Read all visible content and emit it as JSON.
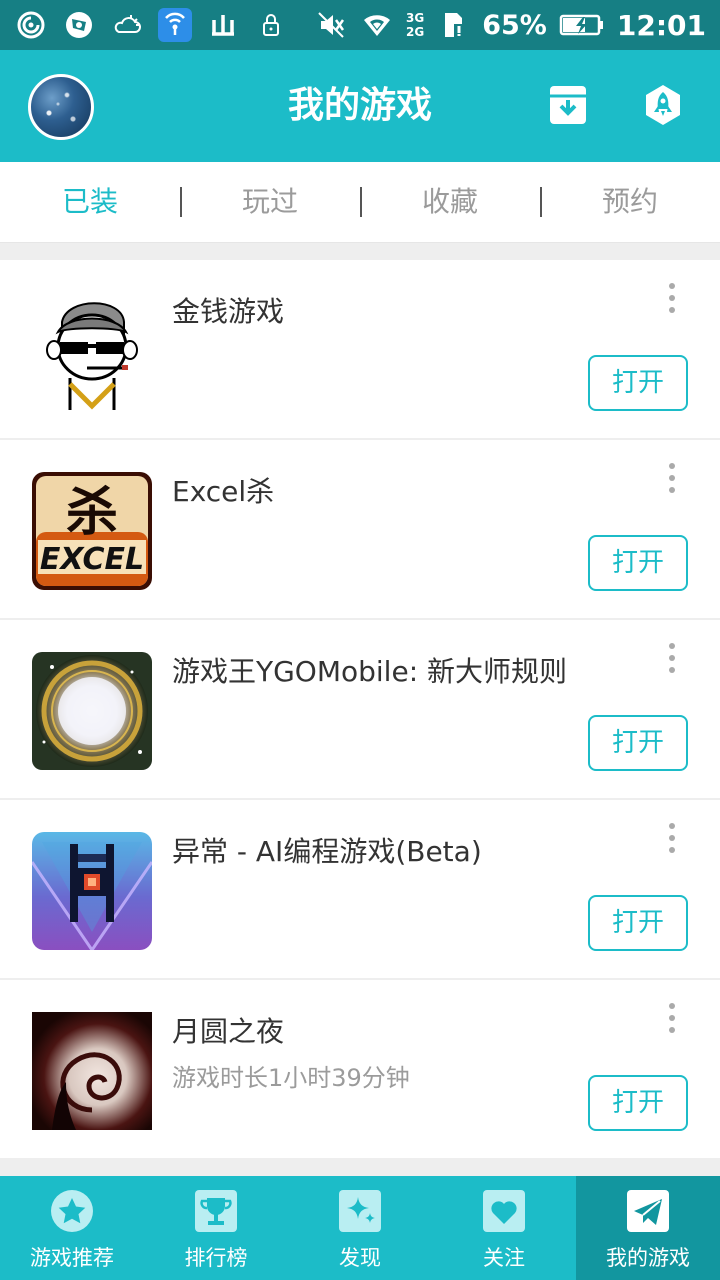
{
  "status_bar": {
    "battery": "65%",
    "time": "12:01",
    "network_top": "3G",
    "network_bottom": "2G",
    "icons": [
      "netease-icon",
      "compass-icon",
      "weather-icon",
      "wifi-hotspot-icon",
      "mountain-icon",
      "lock-icon",
      "mute-icon",
      "wifi-icon",
      "signal-icon",
      "sim-alert-icon",
      "battery-charging-icon"
    ]
  },
  "header": {
    "title": "我的游戏",
    "icons": [
      "avatar",
      "download-box-icon",
      "rocket-icon"
    ]
  },
  "tabs": [
    {
      "label": "已装",
      "active": true
    },
    {
      "label": "玩过",
      "active": false
    },
    {
      "label": "收藏",
      "active": false
    },
    {
      "label": "预约",
      "active": false
    }
  ],
  "games": [
    {
      "name": "金钱游戏",
      "subtitle": "",
      "button": "打开"
    },
    {
      "name": "Excel杀",
      "subtitle": "",
      "button": "打开"
    },
    {
      "name": "游戏王YGOMobile: 新大师规则",
      "subtitle": "",
      "button": "打开"
    },
    {
      "name": "异常 - AI编程游戏(Beta)",
      "subtitle": "",
      "button": "打开"
    },
    {
      "name": "月圆之夜",
      "subtitle": "游戏时长1小时39分钟",
      "button": "打开"
    }
  ],
  "bottom_nav": [
    {
      "label": "游戏推荐",
      "icon": "star-icon",
      "active": false
    },
    {
      "label": "排行榜",
      "icon": "trophy-icon",
      "active": false
    },
    {
      "label": "发现",
      "icon": "sparkle-icon",
      "active": false
    },
    {
      "label": "关注",
      "icon": "heart-icon",
      "active": false
    },
    {
      "label": "我的游戏",
      "icon": "paper-plane-icon",
      "active": true
    }
  ],
  "colors": {
    "accent": "#1cbcc8",
    "status_bar": "#167f84",
    "active_nav": "#12969f",
    "text": "#333333",
    "muted": "#9b9b9b"
  }
}
